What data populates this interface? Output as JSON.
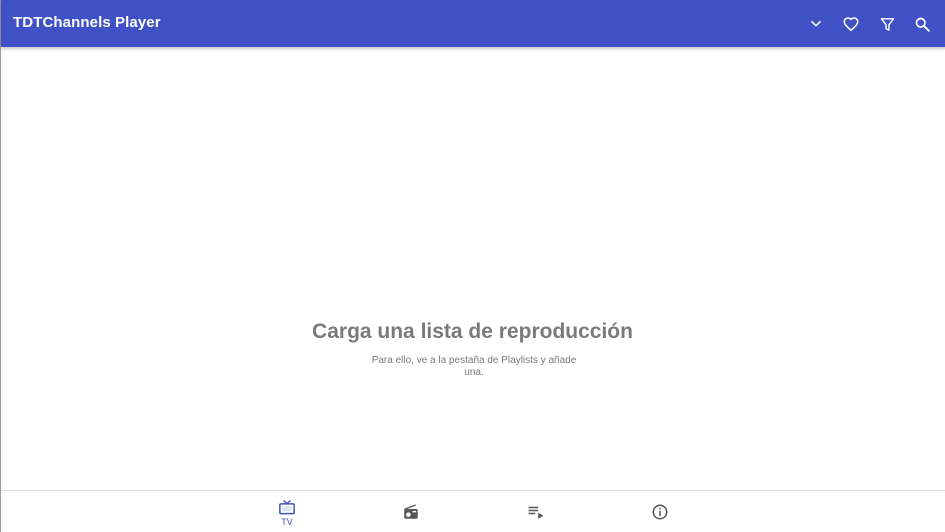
{
  "app": {
    "title": "TDTChannels Player"
  },
  "toolbar": {
    "actions": [
      {
        "name": "dropdown",
        "icon": "chevron-down-icon"
      },
      {
        "name": "favorites",
        "icon": "heart-outline-icon"
      },
      {
        "name": "filter",
        "icon": "filter-icon"
      },
      {
        "name": "search",
        "icon": "search-icon"
      }
    ]
  },
  "empty_state": {
    "title": "Carga una lista de reproducción",
    "subtitle": "Para ello, ve a la pestaña de Playlists y añade una."
  },
  "bottom_nav": {
    "items": [
      {
        "label": "TV",
        "icon": "tv-icon",
        "active": true
      },
      {
        "label": "",
        "icon": "radio-icon",
        "active": false
      },
      {
        "label": "",
        "icon": "playlist-play-icon",
        "active": false
      },
      {
        "label": "",
        "icon": "info-icon",
        "active": false
      }
    ]
  },
  "colors": {
    "primary": "#3f51c5",
    "on_primary": "#ffffff",
    "muted_text": "#7a7a7a",
    "inactive_icon": "#555555",
    "divider": "#e2e2e2"
  }
}
